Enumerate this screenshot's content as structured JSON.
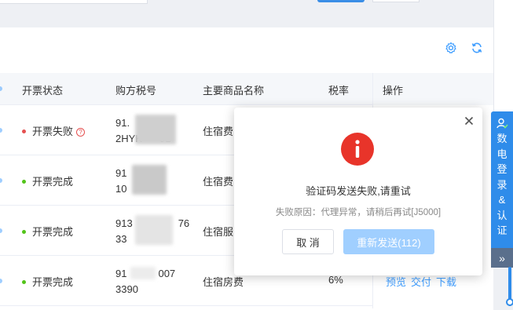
{
  "table": {
    "headers": {
      "status": "开票状态",
      "buyer_tax_no": "购方税号",
      "goods_name": "主要商品名称",
      "tax_rate": "税率",
      "actions": "操作"
    },
    "rows": [
      {
        "status": "开票失败",
        "status_color": "#e55050",
        "has_help": true,
        "tax_line1": "91.",
        "tax_line2": "2HYK",
        "tax_line2_tail": "9B",
        "goods": "住宿费",
        "rate": "",
        "actions": []
      },
      {
        "status": "开票完成",
        "status_color": "#52c41a",
        "has_help": false,
        "tax_line1": "91",
        "tax_line2": "10",
        "tax_line2_tail": "",
        "goods": "住宿费",
        "rate": "",
        "actions": []
      },
      {
        "status": "开票完成",
        "status_color": "#52c41a",
        "has_help": false,
        "tax_line1": "913",
        "tax_line2": "33",
        "tax_line2_tail": "",
        "tax_line1_tail": "76",
        "goods": "住宿服",
        "rate": "",
        "actions": []
      },
      {
        "status": "开票完成",
        "status_color": "#52c41a",
        "has_help": false,
        "tax_line1": "91",
        "tax_line1_tail": "007",
        "tax_line2": "3390",
        "tax_line2_tail": "",
        "goods": "住宿房费",
        "rate": "6%",
        "actions": [
          "预览",
          "交付",
          "下载"
        ]
      }
    ]
  },
  "toolbar": {
    "settings_icon": "gear-icon",
    "refresh_icon": "refresh-icon"
  },
  "dialog": {
    "icon": "exclamation-icon",
    "message": "验证码发送失败,请重试",
    "reason": "失败原因：代理异常，请稍后再试[J5000]",
    "cancel_label": "取 消",
    "resend_label": "重新发送(112)",
    "close_icon": "close-icon",
    "accent_color": "#e8342a"
  },
  "side_panel": {
    "label_chars": [
      "数",
      "电",
      "登",
      "录",
      "&",
      "认",
      "证"
    ],
    "collapse_label": "»",
    "color": "#2f8cea"
  }
}
